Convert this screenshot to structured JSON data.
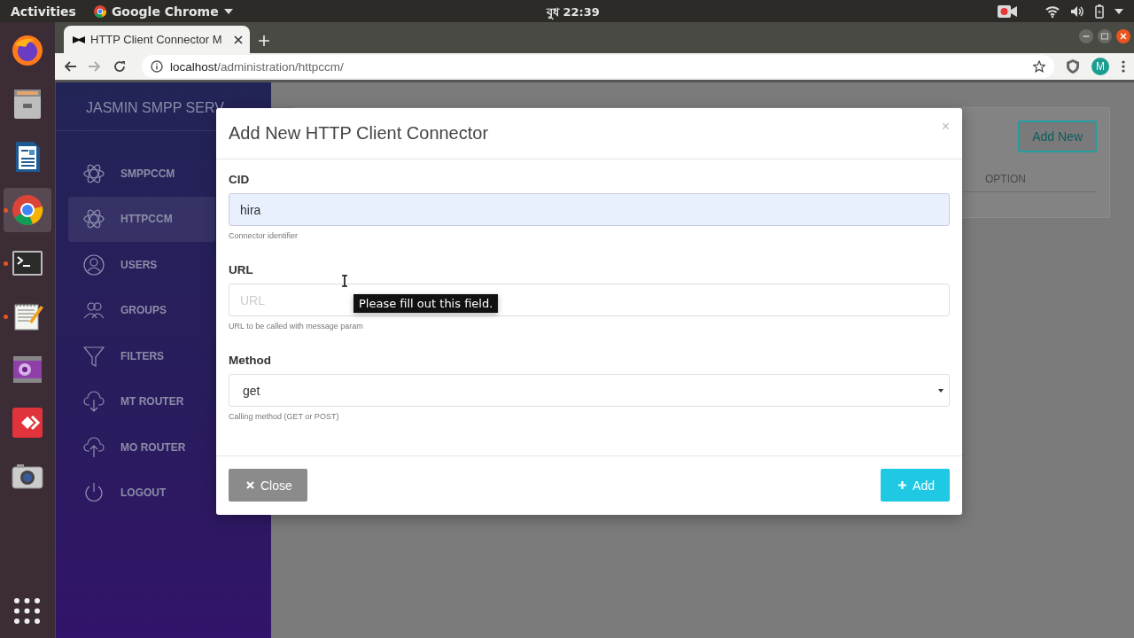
{
  "top_bar": {
    "activities": "Activities",
    "app_menu": "Google Chrome",
    "clock": "বুধ 22:39"
  },
  "dock": {
    "apps": [
      {
        "kind": "firefox",
        "running": false,
        "selected": false
      },
      {
        "kind": "files",
        "running": false,
        "selected": false
      },
      {
        "kind": "writer",
        "running": false,
        "selected": false
      },
      {
        "kind": "chrome",
        "running": true,
        "selected": true
      },
      {
        "kind": "terminal",
        "running": true,
        "selected": false
      },
      {
        "kind": "editor",
        "running": true,
        "selected": false
      },
      {
        "kind": "video",
        "running": false,
        "selected": false
      },
      {
        "kind": "remote",
        "running": false,
        "selected": false
      },
      {
        "kind": "camera",
        "running": false,
        "selected": false
      }
    ]
  },
  "browser": {
    "tabs": [
      {
        "title": "HTTP Client Connector M",
        "selected": true
      }
    ],
    "address_host": "localhost",
    "address_path": "/administration/httpccm/",
    "profile_initial": "M"
  },
  "sidebar": {
    "brand": "JASMIN SMPP SERV",
    "items": [
      {
        "kind": "atom",
        "label": "SMPPCCM",
        "selected": false
      },
      {
        "kind": "atom",
        "label": "HTTPCCM",
        "selected": true
      },
      {
        "kind": "user",
        "label": "USERS",
        "selected": false
      },
      {
        "kind": "group",
        "label": "GROUPS",
        "selected": false
      },
      {
        "kind": "filter",
        "label": "FILTERS",
        "selected": false
      },
      {
        "kind": "cloud-down",
        "label": "MT ROUTER",
        "selected": false
      },
      {
        "kind": "cloud-up",
        "label": "MO ROUTER",
        "selected": false
      },
      {
        "kind": "power",
        "label": "LOGOUT",
        "selected": false
      }
    ]
  },
  "main": {
    "add_button": "Add New",
    "table": {
      "columns": [
        "OPTION"
      ]
    }
  },
  "modal": {
    "title": "Add New HTTP Client Connector",
    "close": "×",
    "fields": [
      {
        "kind": "text",
        "label": "CID",
        "value": "hira",
        "help": "Connector identifier",
        "autofilled": true
      },
      {
        "kind": "text",
        "label": "URL",
        "placeholder": "URL",
        "help": "URL to be called with message param",
        "autofilled": false
      },
      {
        "kind": "select",
        "label": "Method",
        "value": "get",
        "help": "Calling method (GET or POST)"
      }
    ],
    "buttons": [
      {
        "kind": "close",
        "label": "Close"
      },
      {
        "kind": "add",
        "label": "Add"
      }
    ]
  },
  "validation_tooltip": "Please fill out this field."
}
